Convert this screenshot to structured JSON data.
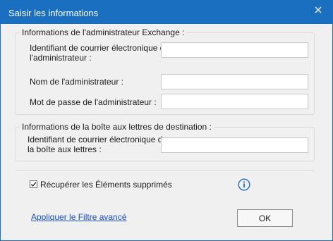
{
  "window": {
    "title": "Saisir les informations",
    "accent": "#1b6fc0"
  },
  "admin_group": {
    "legend": "Informations de l'administrateur Exchange :",
    "email_label_line1": "Identifiant de courrier électronique de",
    "email_label_line2": "l'administrateur :",
    "name_label": "Nom de l'administrateur :",
    "password_label": "Mot de passe de l'administrateur :",
    "email_value": "",
    "name_value": "",
    "password_value": ""
  },
  "dest_group": {
    "legend": "Informations de la boîte aux lettres de destination :",
    "email_label_line1": "Identifiant de courrier électronique de",
    "email_label_line2": "la boîte aux lettres :",
    "email_value": ""
  },
  "options": {
    "recover_deleted_label": "Récupérer les Éléments supprimés",
    "recover_deleted_checked": true
  },
  "footer": {
    "advanced_filter_link": "Appliquer le Filtre avancé",
    "ok_label": "OK"
  }
}
